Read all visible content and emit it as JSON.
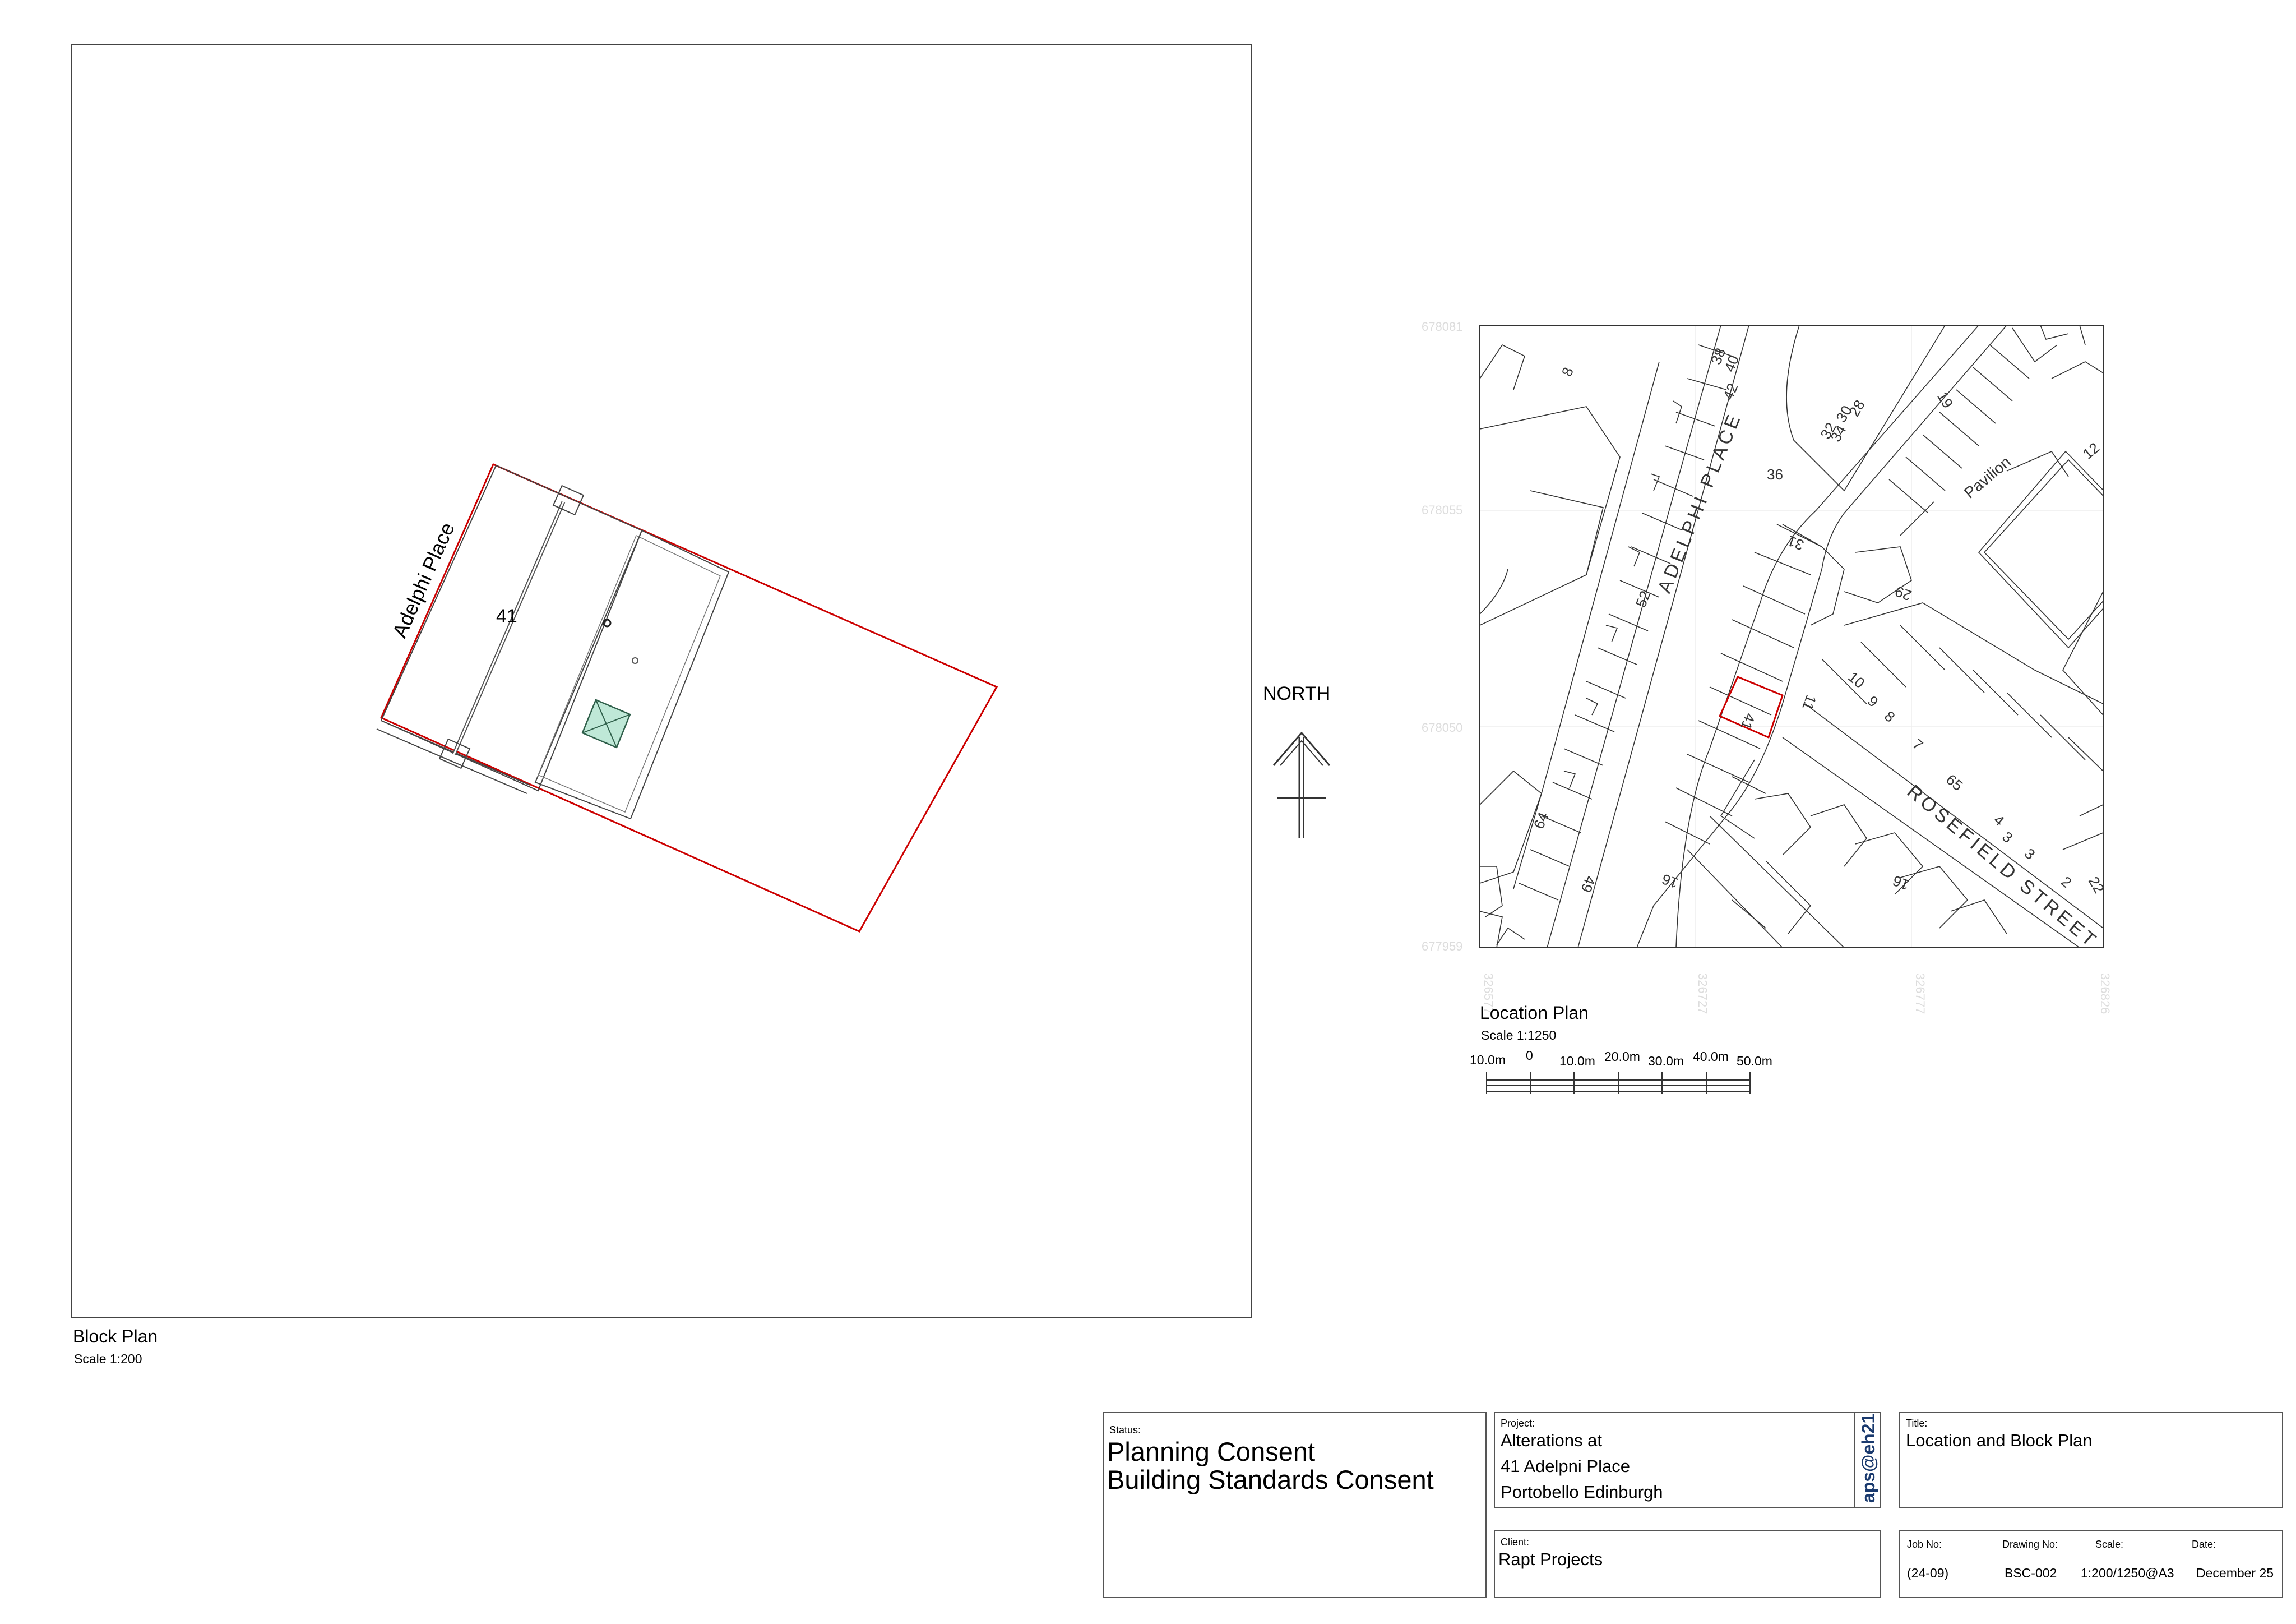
{
  "block_plan": {
    "title": "Block Plan",
    "scale": "Scale 1:200",
    "street_label": "Adelphi Place",
    "plot_number": "41",
    "boundary_color": "#cc0000"
  },
  "north_label": "NORTH",
  "location_plan": {
    "title": "Location Plan",
    "scale": "Scale 1:1250",
    "grid_labels_y": [
      "678081",
      "678055",
      "678050",
      "677959"
    ],
    "grid_labels_x": [
      "326577",
      "326727",
      "326777",
      "326826"
    ],
    "street_labels": [
      "ADELPHI PLACE",
      "ROSEFIELD STREET",
      "Pavilion"
    ],
    "house_numbers": [
      "8",
      "38",
      "40",
      "42",
      "32",
      "30",
      "34",
      "28",
      "19",
      "12",
      "36",
      "31",
      "52",
      "29",
      "41",
      "11",
      "10",
      "9",
      "8",
      "7",
      "65",
      "4",
      "3",
      "2",
      "22",
      "64",
      "49",
      "16",
      "16",
      "3"
    ],
    "highlight_color": "#cc0000",
    "scale_bar_labels": [
      "10.0m",
      "0",
      "10.0m",
      "20.0m",
      "30.0m",
      "40.0m",
      "50.0m"
    ]
  },
  "title_block": {
    "status_label": "Status:",
    "status_line1": "Planning Consent",
    "status_line2": "Building Standards Consent",
    "project_label": "Project:",
    "project_line1": "Alterations at",
    "project_line2": "41 Adelpni Place",
    "project_line3": "Portobello Edinburgh",
    "logo_text": "aps@eh21",
    "title_label": "Title:",
    "title_value": "Location and Block Plan",
    "client_label": "Client:",
    "client_value": "Rapt Projects",
    "job_no_label": "Job No:",
    "job_no": "(24-09)",
    "drawing_no_label": "Drawing No:",
    "drawing_no": "BSC-002",
    "scale_label": "Scale:",
    "scale_value": "1:200/1250@A3",
    "date_label": "Date:",
    "date_value": "December 25"
  }
}
